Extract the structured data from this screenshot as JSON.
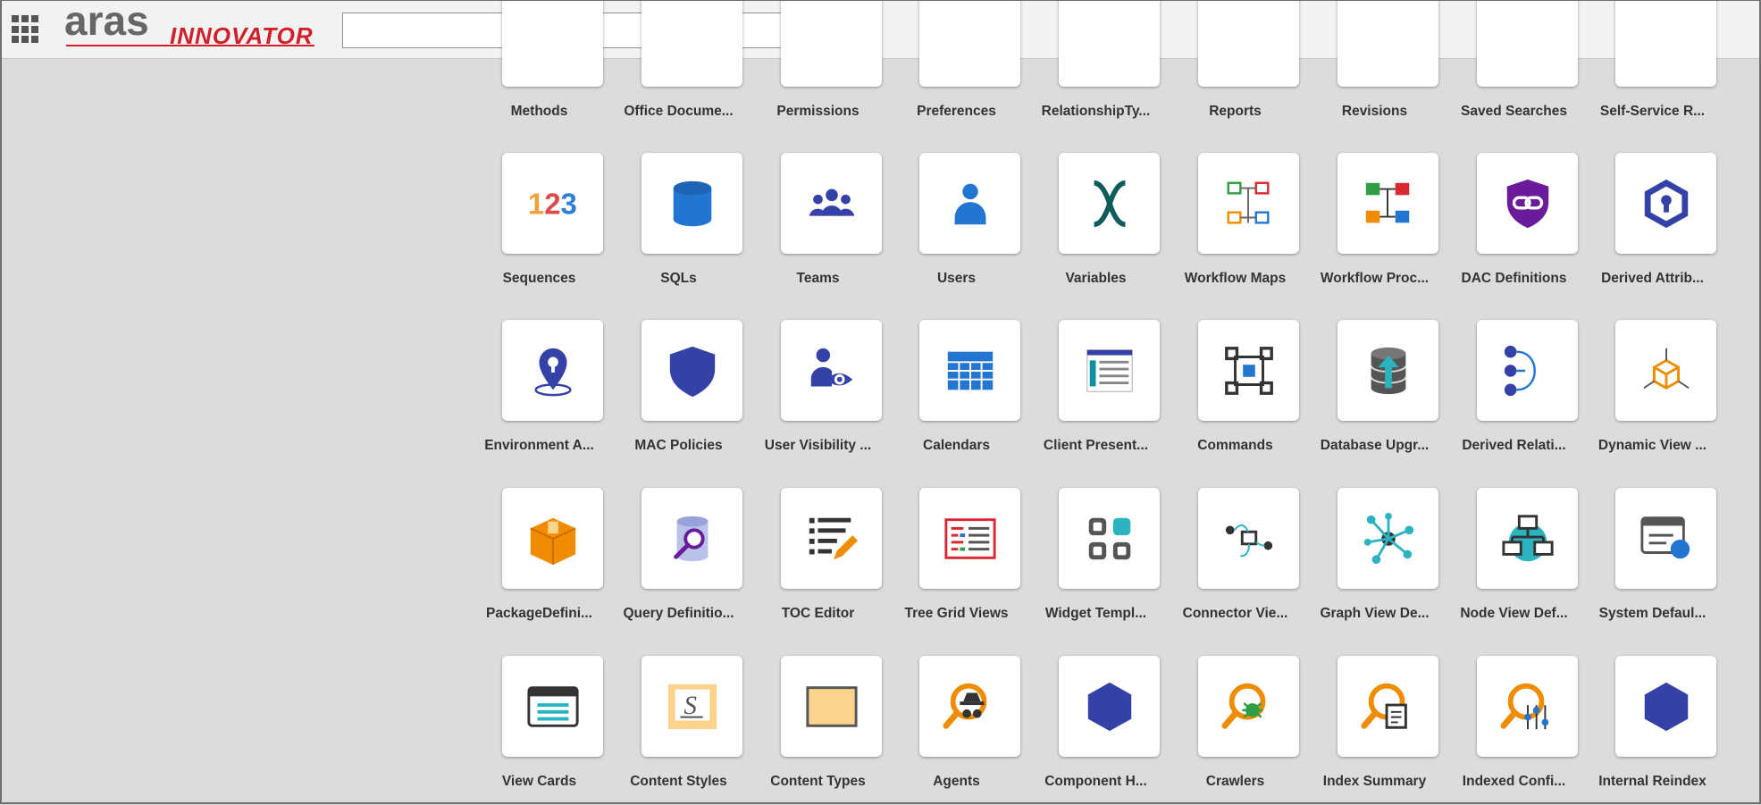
{
  "header": {
    "app_menu_icon": "grid-icon",
    "logo": {
      "primary": "aras",
      "secondary": "INNOVATOR",
      "primary_color": "#666666",
      "accent_color": "#d0202a"
    },
    "search": {
      "value": "",
      "placeholder": "",
      "button_icon": "search-icon"
    }
  },
  "grid": {
    "rows": [
      [
        {
          "label": "Methods",
          "icon": "blank"
        },
        {
          "label": "Office Docume...",
          "icon": "blank"
        },
        {
          "label": "Permissions",
          "icon": "blank"
        },
        {
          "label": "Preferences",
          "icon": "blank"
        },
        {
          "label": "RelationshipTy...",
          "icon": "blank"
        },
        {
          "label": "Reports",
          "icon": "blank"
        },
        {
          "label": "Revisions",
          "icon": "blank"
        },
        {
          "label": "Saved Searches",
          "icon": "blank"
        },
        {
          "label": "Self-Service R...",
          "icon": "blank"
        }
      ],
      [
        {
          "label": "Sequences",
          "icon": "numbers-123-icon"
        },
        {
          "label": "SQLs",
          "icon": "database-cylinder-icon"
        },
        {
          "label": "Teams",
          "icon": "team-people-icon"
        },
        {
          "label": "Users",
          "icon": "user-person-icon"
        },
        {
          "label": "Variables",
          "icon": "variable-x-icon"
        },
        {
          "label": "Workflow Maps",
          "icon": "workflow-map-icon"
        },
        {
          "label": "Workflow Proc...",
          "icon": "workflow-process-icon"
        },
        {
          "label": "DAC Definitions",
          "icon": "shield-link-icon"
        },
        {
          "label": "Derived Attrib...",
          "icon": "hexagon-keyhole-icon"
        }
      ],
      [
        {
          "label": "Environment A...",
          "icon": "location-pin-icon"
        },
        {
          "label": "MAC Policies",
          "icon": "shield-icon"
        },
        {
          "label": "User Visibility ...",
          "icon": "user-eye-icon"
        },
        {
          "label": "Calendars",
          "icon": "calendar-grid-icon"
        },
        {
          "label": "Client Present...",
          "icon": "presentation-form-icon"
        },
        {
          "label": "Commands",
          "icon": "command-icon"
        },
        {
          "label": "Database Upgr...",
          "icon": "database-upgrade-icon"
        },
        {
          "label": "Derived Relati...",
          "icon": "derived-relationship-icon"
        },
        {
          "label": "Dynamic View ...",
          "icon": "dynamic-cube-icon"
        }
      ],
      [
        {
          "label": "PackageDefini...",
          "icon": "package-box-icon"
        },
        {
          "label": "Query Definitio...",
          "icon": "query-database-icon"
        },
        {
          "label": "TOC Editor",
          "icon": "toc-list-edit-icon"
        },
        {
          "label": "Tree Grid Views",
          "icon": "tree-grid-icon"
        },
        {
          "label": "Widget Templ...",
          "icon": "widget-template-icon"
        },
        {
          "label": "Connector Vie...",
          "icon": "connector-view-icon"
        },
        {
          "label": "Graph View De...",
          "icon": "graph-network-icon"
        },
        {
          "label": "Node View Def...",
          "icon": "node-view-icon"
        },
        {
          "label": "System Defaul...",
          "icon": "system-default-window-icon"
        }
      ],
      [
        {
          "label": "View Cards",
          "icon": "view-card-icon"
        },
        {
          "label": "Content Styles",
          "icon": "content-style-icon"
        },
        {
          "label": "Content Types",
          "icon": "content-type-icon"
        },
        {
          "label": "Agents",
          "icon": "search-agent-icon"
        },
        {
          "label": "Component H...",
          "icon": "hexagon-icon"
        },
        {
          "label": "Crawlers",
          "icon": "search-crawler-icon"
        },
        {
          "label": "Index Summary",
          "icon": "search-index-icon"
        },
        {
          "label": "Indexed Confi...",
          "icon": "search-config-icon"
        },
        {
          "label": "Internal Reindex",
          "icon": "hexagon-icon"
        }
      ]
    ]
  }
}
